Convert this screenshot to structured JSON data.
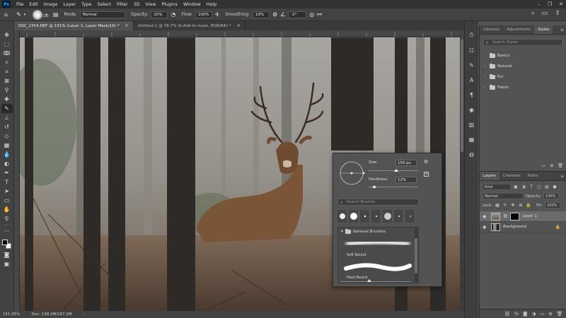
{
  "app": {
    "logo": "Ps"
  },
  "menu": [
    "File",
    "Edit",
    "Image",
    "Layer",
    "Type",
    "Select",
    "Filter",
    "3D",
    "View",
    "Plugins",
    "Window",
    "Help"
  ],
  "window_controls": [
    "–",
    "❐",
    "✕"
  ],
  "options_bar": {
    "brush_size": "150",
    "mode_label": "Mode:",
    "mode_value": "Normal",
    "opacity_label": "Opacity:",
    "opacity_value": "20%",
    "flow_label": "Flow:",
    "flow_value": "100%",
    "smoothing_label": "Smoothing:",
    "smoothing_value": "10%",
    "angle_value": "-2°"
  },
  "tabs": [
    {
      "label": "DSC_2354.NEF @ 151% (Layer 1, Layer Mask/16) *",
      "active": true
    },
    {
      "label": "Untitled-1 @ 78.7% (6.Add-to-mask, RGB/8#) *",
      "active": false
    }
  ],
  "status": {
    "zoom": "151.05%",
    "doc": "Doc: 138.2M/167.2M"
  },
  "brush_popup": {
    "size_label": "Size:",
    "size_value": "150 px",
    "size_level": 0.55,
    "hardness_label": "Hardness:",
    "hardness_value": "12%",
    "hardness_level": 0.12,
    "search_placeholder": "Search Brushes",
    "folder_name": "General Brushes",
    "brushes": [
      "Soft Round",
      "Hard Round"
    ]
  },
  "top_panel": {
    "tabs": [
      "Libraries",
      "Adjustments",
      "Styles"
    ],
    "active_tab": "Styles",
    "search_placeholder": "Search Styles",
    "folders": [
      "Basics",
      "Natural",
      "Fur",
      "Fabric"
    ]
  },
  "layers_panel": {
    "tabs": [
      "Layers",
      "Channels",
      "Paths"
    ],
    "active_tab": "Layers",
    "filter_value": "Kind",
    "blend_mode": "Normal",
    "opacity_label": "Opacity:",
    "opacity_value": "100%",
    "lock_label": "Lock:",
    "fill_label": "Fill:",
    "fill_value": "100%",
    "layers": [
      {
        "name": "Layer 1",
        "selected": true
      },
      {
        "name": "Background",
        "selected": false
      }
    ]
  },
  "colors": {
    "accent": "#31a8ff",
    "panel": "#535353",
    "chrome": "#424242"
  }
}
